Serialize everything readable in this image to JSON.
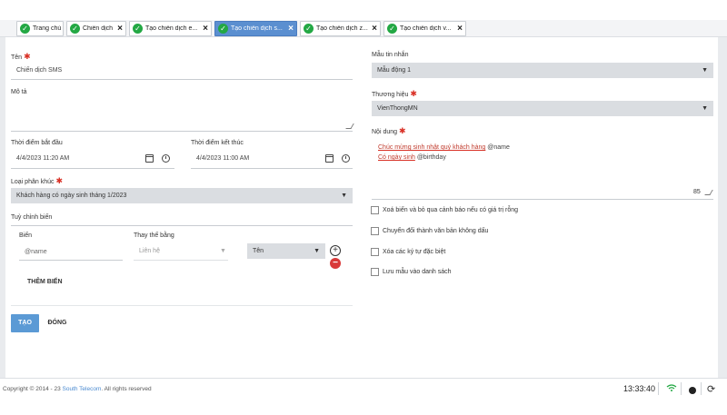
{
  "tabs": [
    {
      "label": "Trang chủ",
      "closable": false,
      "active": false
    },
    {
      "label": "Chiến dịch",
      "closable": true,
      "active": false
    },
    {
      "label": "Tạo chiến dịch e...",
      "closable": true,
      "active": false
    },
    {
      "label": "Tạo chiến dịch s...",
      "closable": true,
      "active": true
    },
    {
      "label": "Tạo chiến dịch z...",
      "closable": true,
      "active": false
    },
    {
      "label": "Tạo chiến dịch v...",
      "closable": true,
      "active": false
    }
  ],
  "form": {
    "name_label": "Tên",
    "name_value": "Chiến dịch SMS",
    "desc_label": "Mô tả",
    "start_label": "Thời điểm bắt đầu",
    "start_value": "4/4/2023 11:20 AM",
    "end_label": "Thời điểm kết thúc",
    "end_value": "4/4/2023 11:00 AM",
    "segment_label": "Loại phân khúc",
    "segment_value": "Khách hàng có ngày sinh tháng 1/2023",
    "customize_label": "Tuỳ chỉnh biến",
    "var_col_label": "Biến",
    "replace_col_label": "Thay thế bằng",
    "var_name": "@name",
    "replace_source": "Liên hệ",
    "replace_field": "Tên",
    "add_var_label": "THÊM BIẾN",
    "create_label": "TẠO",
    "close_label": "ĐÓNG"
  },
  "right": {
    "template_label": "Mẫu tin nhắn",
    "template_value": "Mẫu động 1",
    "brand_label": "Thương hiệu",
    "brand_value": "VienThongMN",
    "content_label": "Nội dung",
    "content_line1_text": "Chúc mừng sinh nhật quý khách hàng",
    "content_line1_token": "@name",
    "content_line2_text": "Có ngày sinh",
    "content_line2_token": "@birthday",
    "char_count": "85",
    "options": [
      "Xoá biến và bỏ qua cảnh báo nếu có giá trị rỗng",
      "Chuyển đổi thành văn bản không dấu",
      "Xóa các ký tự đặc biệt",
      "Lưu mẫu vào danh sách"
    ]
  },
  "footer": {
    "copyright_prefix": "Copyright © 2014 - 23",
    "brand": "South Telecom",
    "copyright_suffix": ". All rights reserved",
    "time": "13:33:40"
  },
  "colors": {
    "accent": "#5b9ad5",
    "active_tab": "#5b8fd0",
    "required": "#d93025",
    "success": "#23a844"
  }
}
